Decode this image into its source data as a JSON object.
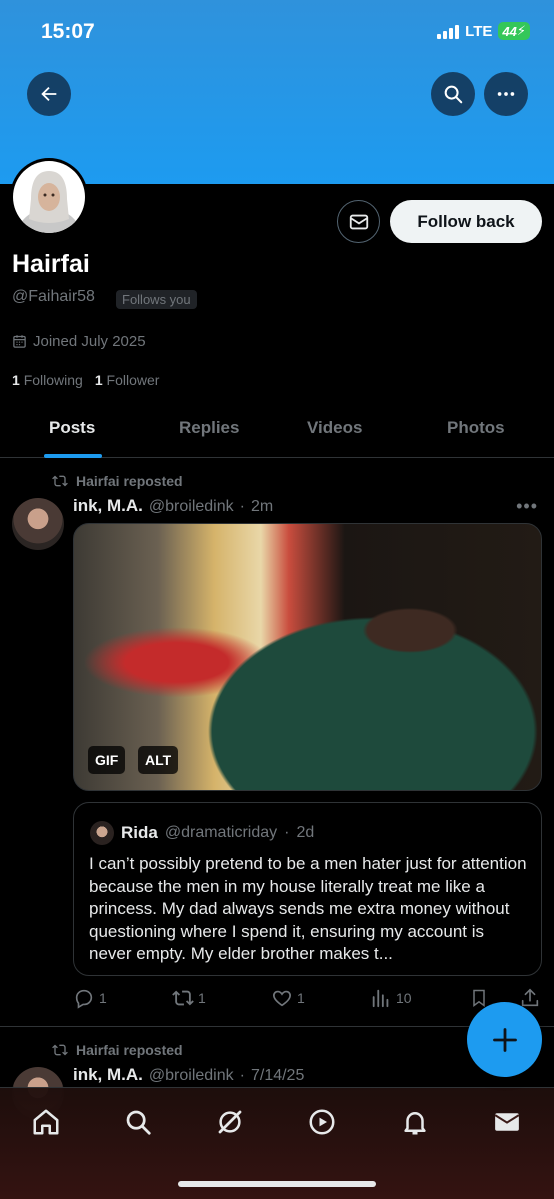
{
  "status_bar": {
    "time": "15:07",
    "network": "LTE",
    "battery": "44"
  },
  "header": {
    "back_label": "Back",
    "search_label": "Search",
    "more_label": "More"
  },
  "profile": {
    "name": "Hairfai",
    "handle": "@Faihair58",
    "follows_you": "Follows you",
    "joined": "Joined July 2025",
    "following_count": "1",
    "following_label": "Following",
    "followers_count": "1",
    "followers_label": "Follower",
    "follow_back_label": "Follow back"
  },
  "tabs": [
    {
      "label": "Posts",
      "active": true
    },
    {
      "label": "Replies",
      "active": false
    },
    {
      "label": "Videos",
      "active": false
    },
    {
      "label": "Photos",
      "active": false
    }
  ],
  "posts": [
    {
      "repost_label": "Hairfai reposted",
      "author": "ink, M.A.",
      "handle": "@broiledink",
      "time": "2m",
      "media_tags": [
        "GIF",
        "ALT"
      ],
      "quote": {
        "author": "Rida",
        "handle": "@dramaticriday",
        "time": "2d",
        "text": "I can’t possibly pretend to be a men hater just for attention because the men in my house literally treat me like a princess. My dad always sends me extra money without questioning where I spend it, ensuring my account is never empty. My elder brother makes t..."
      },
      "actions": {
        "replies": "1",
        "reposts": "1",
        "likes": "1",
        "views": "10"
      }
    },
    {
      "repost_label": "Hairfai reposted",
      "author": "ink, M.A.",
      "handle": "@broiledink",
      "time": "7/14/25"
    }
  ],
  "colors": {
    "accent": "#1d9bf0",
    "background": "#000000",
    "muted": "#71767b"
  },
  "nav": [
    "home-icon",
    "search-icon",
    "grok-icon",
    "video-icon",
    "notifications-icon",
    "messages-icon"
  ]
}
